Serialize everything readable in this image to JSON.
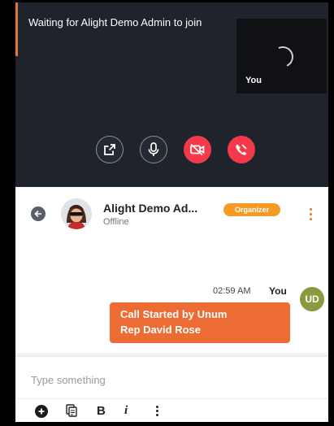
{
  "call": {
    "waiting_text": "Waiting for Alight Demo Admin to join",
    "self_view_label": "You",
    "controls": [
      {
        "id": "popout",
        "icon": "popout-icon",
        "state": "default"
      },
      {
        "id": "microphone",
        "icon": "microphone-icon",
        "state": "on"
      },
      {
        "id": "camera",
        "icon": "video-off-icon",
        "state": "off"
      },
      {
        "id": "end_call",
        "icon": "hang-up-icon",
        "state": "active"
      }
    ],
    "colors": {
      "background": "#1e232c",
      "danger": "#f43a4a",
      "accent": "#e2773a"
    }
  },
  "chat_header": {
    "contact_name": "Alight Demo Ad...",
    "contact_status": "Offline",
    "badge": "Organizer",
    "badge_color": "#f59a23"
  },
  "messages": [
    {
      "time": "02:59 AM",
      "sender": "You",
      "avatar_initials": "UD",
      "text_lines": [
        "Call Started by Unum",
        "Rep David Rose"
      ],
      "bubble_color": "#ed6c33"
    }
  ],
  "composer": {
    "placeholder": "Type something",
    "toolbar": {
      "bold_label": "B",
      "italic_label": "i"
    }
  }
}
